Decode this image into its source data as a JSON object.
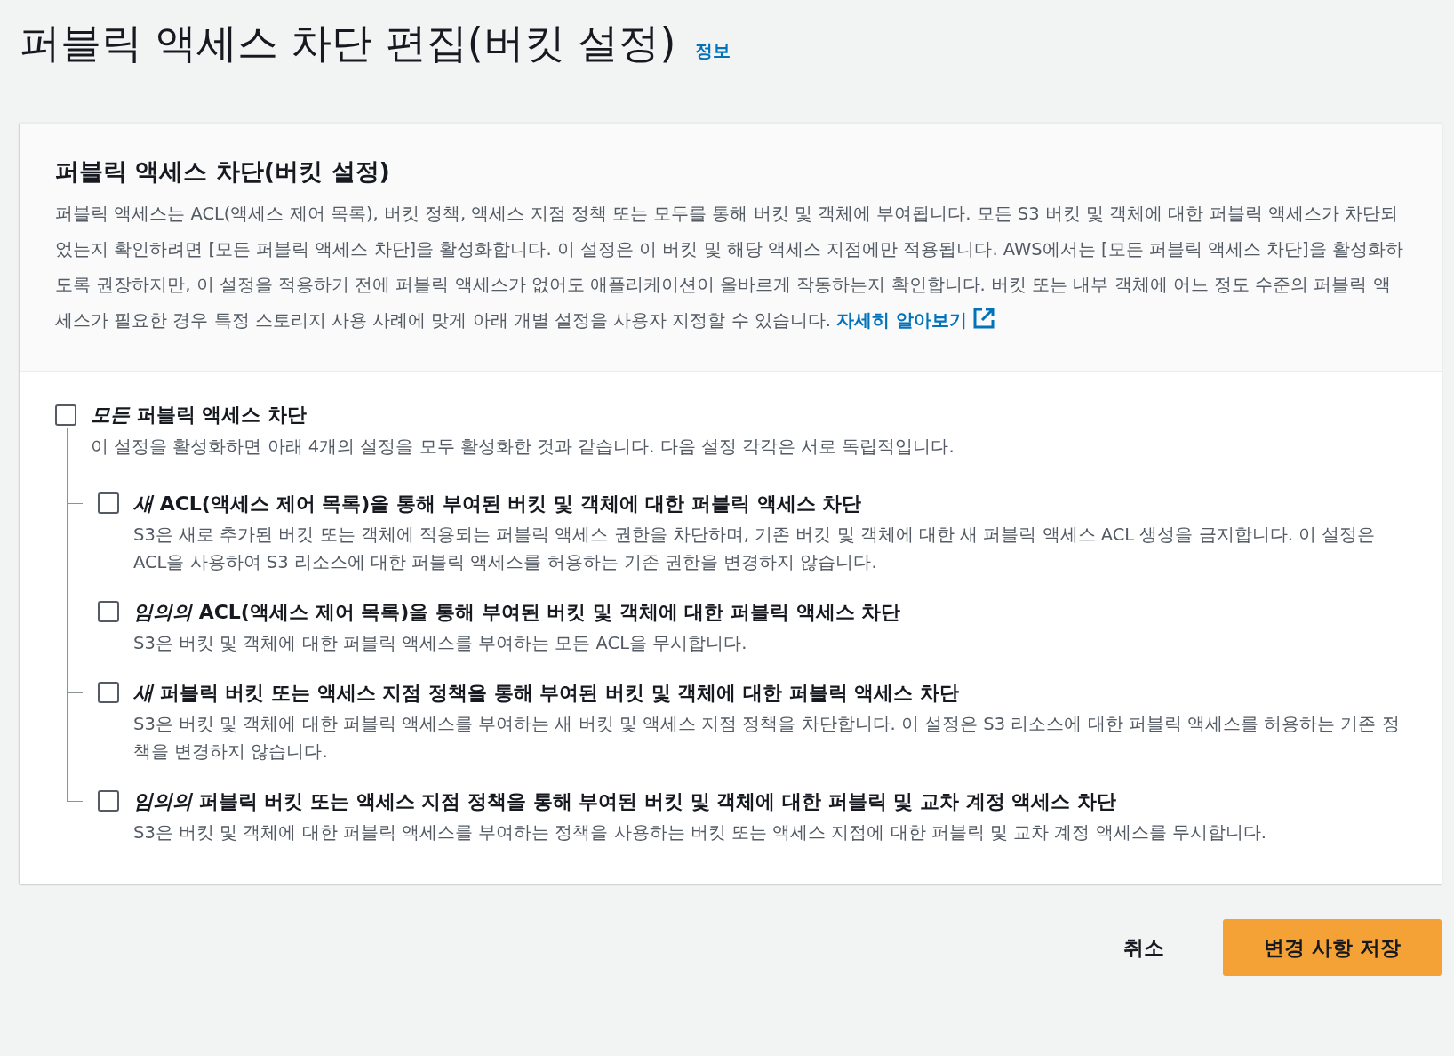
{
  "page": {
    "title": "퍼블릭 액세스 차단 편집(버킷 설정)",
    "info_link": "정보"
  },
  "panel": {
    "heading": "퍼블릭 액세스 차단(버킷 설정)",
    "description": "퍼블릭 액세스는 ACL(액세스 제어 목록), 버킷 정책, 액세스 지점 정책 또는 모두를 통해 버킷 및 객체에 부여됩니다. 모든 S3 버킷 및 객체에 대한 퍼블릭 액세스가 차단되었는지 확인하려면 [모든 퍼블릭 액세스 차단]을 활성화합니다. 이 설정은 이 버킷 및 해당 액세스 지점에만 적용됩니다. AWS에서는 [모든 퍼블릭 액세스 차단]을 활성화하도록 권장하지만, 이 설정을 적용하기 전에 퍼블릭 액세스가 없어도 애플리케이션이 올바르게 작동하는지 확인합니다. 버킷 또는 내부 객체에 어느 정도 수준의 퍼블릭 액세스가 필요한 경우 특정 스토리지 사용 사례에 맞게 아래 개별 설정을 사용자 지정할 수 있습니다.",
    "learn_more": "자세히 알아보기"
  },
  "block_all": {
    "label": "*모든* 퍼블릭 액세스 차단",
    "checked": false,
    "description": "이 설정을 활성화하면 아래 4개의 설정을 모두 활성화한 것과 같습니다. 다음 설정 각각은 서로 독립적입니다."
  },
  "options": [
    {
      "label": "*새* ACL(액세스 제어 목록)을 통해 부여된 버킷 및 객체에 대한 퍼블릭 액세스 차단",
      "checked": false,
      "description": "S3은 새로 추가된 버킷 또는 객체에 적용되는 퍼블릭 액세스 권한을 차단하며, 기존 버킷 및 객체에 대한 새 퍼블릭 액세스 ACL 생성을 금지합니다. 이 설정은 ACL을 사용하여 S3 리소스에 대한 퍼블릭 액세스를 허용하는 기존 권한을 변경하지 않습니다."
    },
    {
      "label": "*임의의* ACL(액세스 제어 목록)을 통해 부여된 버킷 및 객체에 대한 퍼블릭 액세스 차단",
      "checked": false,
      "description": "S3은 버킷 및 객체에 대한 퍼블릭 액세스를 부여하는 모든 ACL을 무시합니다."
    },
    {
      "label": "*새* 퍼블릭 버킷 또는 액세스 지점 정책을 통해 부여된 버킷 및 객체에 대한 퍼블릭 액세스 차단",
      "checked": false,
      "description": "S3은 버킷 및 객체에 대한 퍼블릭 액세스를 부여하는 새 버킷 및 액세스 지점 정책을 차단합니다. 이 설정은 S3 리소스에 대한 퍼블릭 액세스를 허용하는 기존 정책을 변경하지 않습니다."
    },
    {
      "label": "*임의의* 퍼블릭 버킷 또는 액세스 지점 정책을 통해 부여된 버킷 및 객체에 대한 퍼블릭 및 교차 계정 액세스 차단",
      "checked": false,
      "description": "S3은 버킷 및 객체에 대한 퍼블릭 액세스를 부여하는 정책을 사용하는 버킷 또는 액세스 지점에 대한 퍼블릭 및 교차 계정 액세스를 무시합니다."
    }
  ],
  "buttons": {
    "cancel": "취소",
    "save": "변경 사항 저장"
  }
}
